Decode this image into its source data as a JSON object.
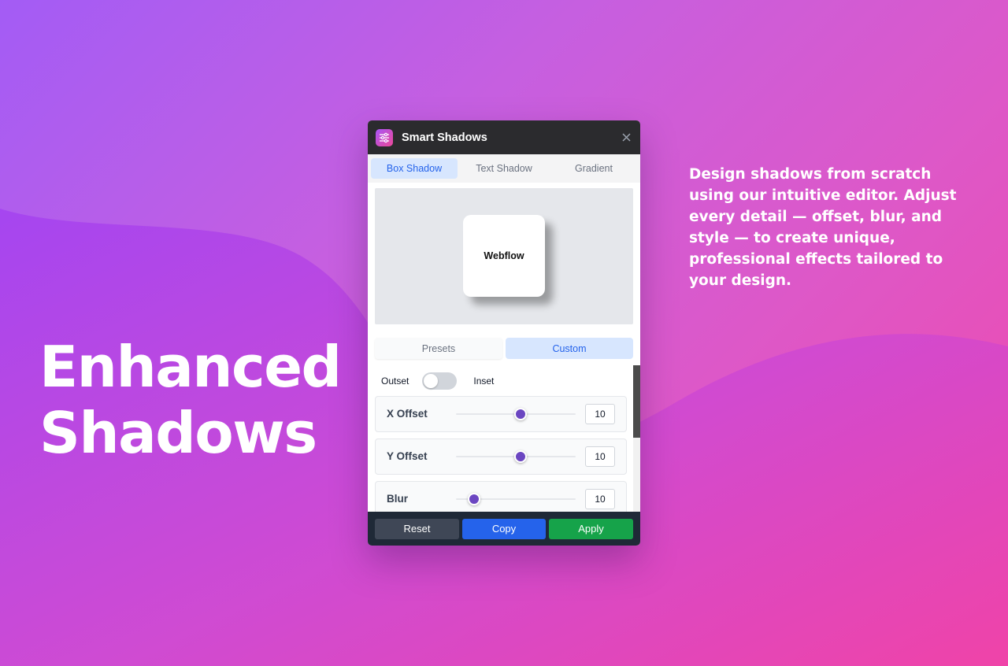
{
  "marketing": {
    "headline_line1": "Enhanced",
    "headline_line2": "Shadows",
    "description": "Design shadows from scratch using our intuitive editor. Adjust every detail — offset, blur, and style — to create unique, professional effects tailored to your design."
  },
  "window": {
    "title": "Smart Shadows",
    "app_icon": "sliders-icon",
    "close_icon": "close-icon"
  },
  "tabs": [
    {
      "label": "Box Shadow",
      "active": true
    },
    {
      "label": "Text Shadow",
      "active": false
    },
    {
      "label": "Gradient",
      "active": false
    }
  ],
  "preview": {
    "card_label": "Webflow"
  },
  "mode_tabs": [
    {
      "label": "Presets",
      "active": false
    },
    {
      "label": "Custom",
      "active": true
    }
  ],
  "toggle": {
    "left_label": "Outset",
    "right_label": "Inset",
    "state": "Outset"
  },
  "sliders": [
    {
      "label": "X Offset",
      "value": "10",
      "fraction": 0.54
    },
    {
      "label": "Y Offset",
      "value": "10",
      "fraction": 0.54
    },
    {
      "label": "Blur",
      "value": "10",
      "fraction": 0.15
    }
  ],
  "footer": {
    "reset_label": "Reset",
    "copy_label": "Copy",
    "apply_label": "Apply"
  },
  "colors": {
    "accent": "#2563eb",
    "apply": "#16a34a",
    "slider_thumb": "#6b46c1",
    "titlebar": "#2b2b2e"
  }
}
